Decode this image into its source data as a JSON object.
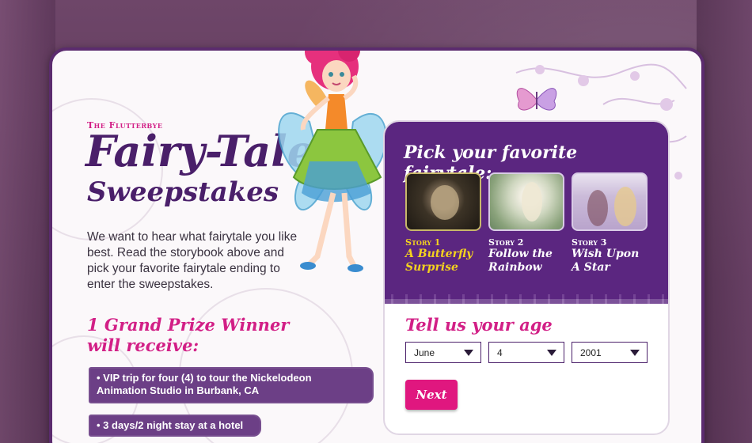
{
  "brand": {
    "small": "The Flutterbye",
    "title": "Fairy-Tale",
    "subtitle": "Sweepstakes"
  },
  "intro": "We want to hear what fairytale you like best. Read the storybook above and pick your favorite fairytale ending to enter the sweepstakes.",
  "prize": {
    "heading": "1 Grand Prize Winner will receive:",
    "items": [
      "• VIP trip for four (4) to tour the Nickelodeon Animation Studio in Burbank, CA",
      "• 3 days/2 night stay at a hotel"
    ]
  },
  "panel": {
    "pick_title": "Pick your favorite fairytale:",
    "stories": [
      {
        "number": "Story 1",
        "name": "A Butterfly Surprise",
        "selected": true
      },
      {
        "number": "Story 2",
        "name": "Follow the Rainbow",
        "selected": false
      },
      {
        "number": "Story 3",
        "name": "Wish Upon A Star",
        "selected": false
      }
    ],
    "age_title": "Tell us your age",
    "month": "June",
    "day": "4",
    "year": "2001",
    "next_label": "Next"
  },
  "colors": {
    "purple": "#5b2680",
    "pink": "#d21f86",
    "highlight": "#f4d21e"
  },
  "icons": [
    "fairy-illustration",
    "butterfly-icon",
    "flowers-decoration",
    "caret-down-icon"
  ]
}
